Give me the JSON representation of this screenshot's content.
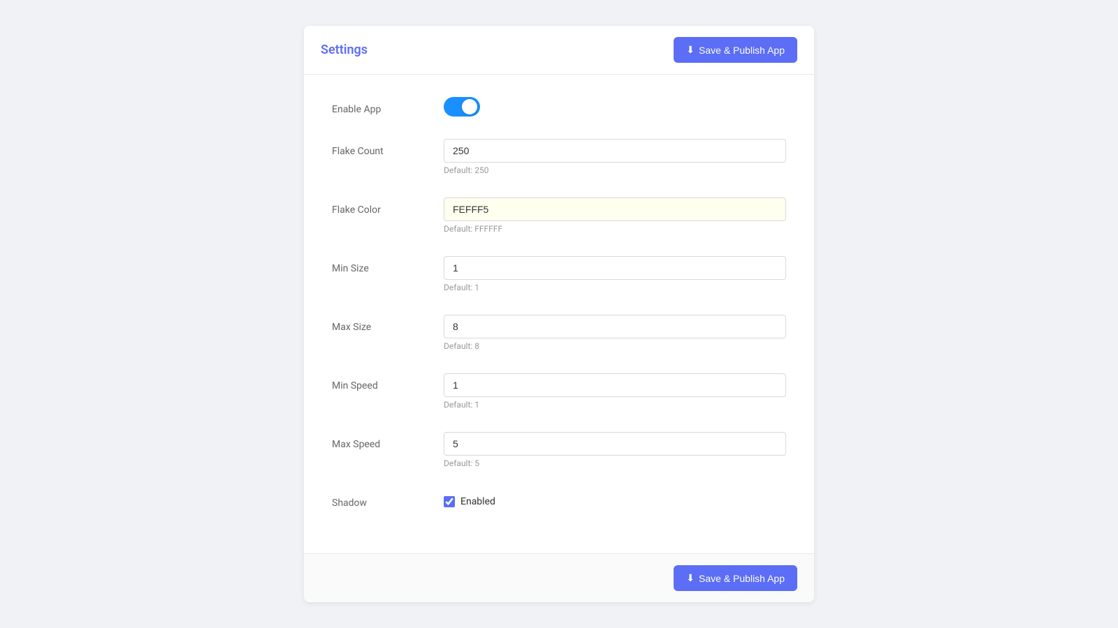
{
  "header": {
    "title": "Settings",
    "save_button_label": "Save & Publish App",
    "save_icon": "⬇"
  },
  "footer": {
    "save_button_label": "Save & Publish App",
    "save_icon": "⬇"
  },
  "form": {
    "enable_app": {
      "label": "Enable App",
      "enabled": true
    },
    "flake_count": {
      "label": "Flake Count",
      "value": "250",
      "hint": "Default: 250"
    },
    "flake_color": {
      "label": "Flake Color",
      "value": "FEFFF5",
      "hint": "Default: FFFFFF"
    },
    "min_size": {
      "label": "Min Size",
      "value": "1",
      "hint": "Default: 1"
    },
    "max_size": {
      "label": "Max Size",
      "value": "8",
      "hint": "Default: 8"
    },
    "min_speed": {
      "label": "Min Speed",
      "value": "1",
      "hint": "Default: 1"
    },
    "max_speed": {
      "label": "Max Speed",
      "value": "5",
      "hint": "Default: 5"
    },
    "shadow": {
      "label": "Shadow",
      "checkbox_label": "Enabled",
      "checked": true
    }
  }
}
